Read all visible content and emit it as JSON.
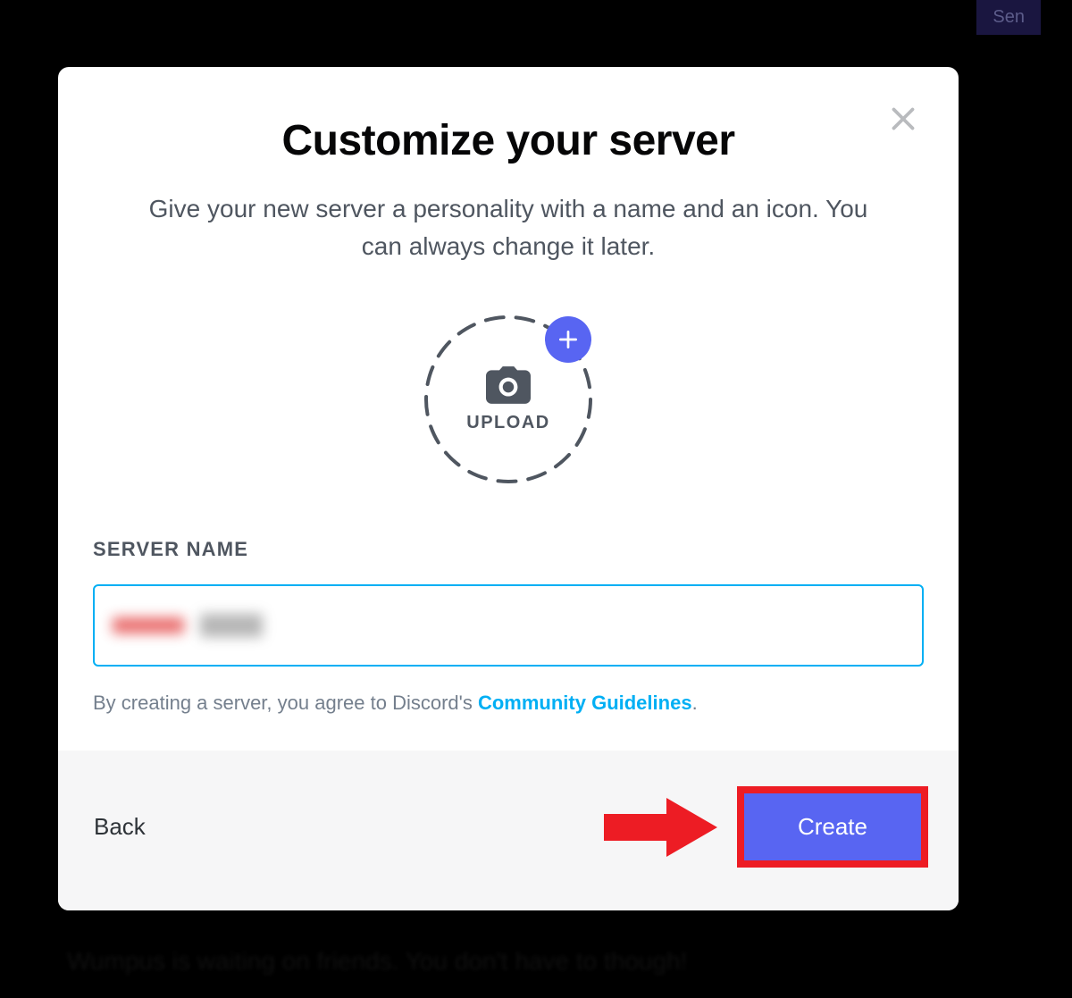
{
  "background": {
    "send_button_partial": "Sen",
    "wumpus_text": "Wumpus is waiting on friends. You don't have to though!"
  },
  "modal": {
    "title": "Customize your server",
    "subtitle": "Give your new server a personality with a name and an icon. You can always change it later.",
    "upload": {
      "label": "UPLOAD",
      "icon_name": "camera-icon",
      "plus_icon_name": "plus-icon"
    },
    "form": {
      "server_name_label": "SERVER NAME",
      "server_name_value": "",
      "guidelines_prefix": "By creating a server, you agree to Discord's ",
      "guidelines_link": "Community Guidelines",
      "guidelines_suffix": "."
    },
    "footer": {
      "back_label": "Back",
      "create_label": "Create"
    }
  },
  "annotation": {
    "arrow_color": "#ed1c24",
    "highlight_color": "#ed1c24"
  },
  "colors": {
    "brand": "#5865f2",
    "link": "#00aff4",
    "text_primary": "#060607",
    "text_secondary": "#4f5660",
    "text_muted": "#747f8d"
  }
}
